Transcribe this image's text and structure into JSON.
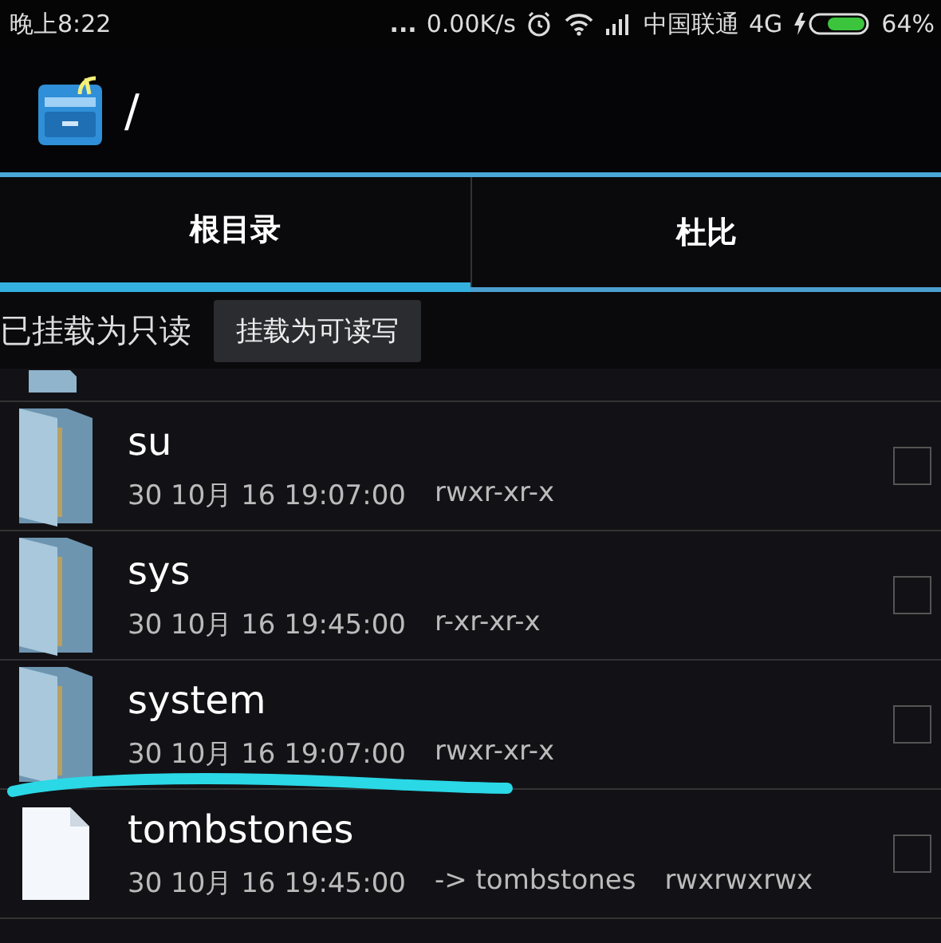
{
  "status_bar": {
    "time": "晚上8:22",
    "dots": "...",
    "speed": "0.00K/s",
    "carrier": "中国联通",
    "network": "4G",
    "battery": "64%"
  },
  "app_bar": {
    "path": "/"
  },
  "tabs": [
    {
      "label": "根目录",
      "selected": true
    },
    {
      "label": "杜比",
      "selected": false
    }
  ],
  "mount_bar": {
    "status": "已挂载为只读",
    "button": "挂载为可读写"
  },
  "files": [
    {
      "kind": "folder",
      "name": "su",
      "date": "30 10月 16 19:07:00",
      "permissions": "rwxr-xr-x",
      "checked": false
    },
    {
      "kind": "folder",
      "name": "sys",
      "date": "30 10月 16 19:45:00",
      "permissions": "r-xr-xr-x",
      "checked": false
    },
    {
      "kind": "folder",
      "name": "system",
      "date": "30 10月 16 19:07:00",
      "permissions": "rwxr-xr-x",
      "checked": false
    },
    {
      "kind": "file",
      "name": "tombstones",
      "date": "30 10月 16 19:45:00",
      "link": "-> tombstones",
      "permissions": "rwxrwxrwx",
      "checked": false
    }
  ]
}
